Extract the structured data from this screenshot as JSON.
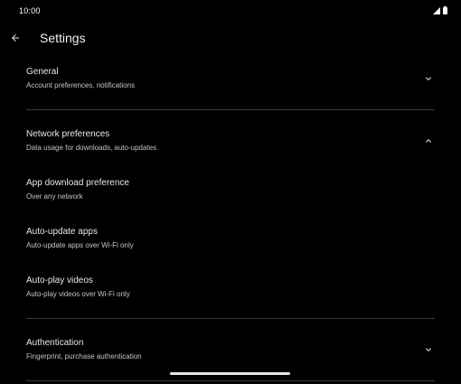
{
  "status_bar": {
    "time": "10:00"
  },
  "app_bar": {
    "title": "Settings"
  },
  "sections": {
    "general": {
      "title": "General",
      "subtitle": "Account preferences, notifications"
    },
    "network": {
      "title": "Network preferences",
      "subtitle": "Data usage for downloads, auto-updates"
    },
    "app_download": {
      "title": "App download preference",
      "subtitle": "Over any network"
    },
    "auto_update": {
      "title": "Auto-update apps",
      "subtitle": "Auto-update apps over Wi-Fi only"
    },
    "auto_play": {
      "title": "Auto-play videos",
      "subtitle": "Auto-play videos over Wi-Fi only"
    },
    "authentication": {
      "title": "Authentication",
      "subtitle": "Fingerprint, purchase authentication"
    }
  },
  "icons": {
    "back": "arrow-left-icon",
    "expand": "chevron-down-icon",
    "collapse": "chevron-up-icon"
  },
  "colors": {
    "background": "#000000",
    "text": "#e8e8e8",
    "subtext": "#c4c4c4",
    "divider": "#3a3a3a"
  }
}
